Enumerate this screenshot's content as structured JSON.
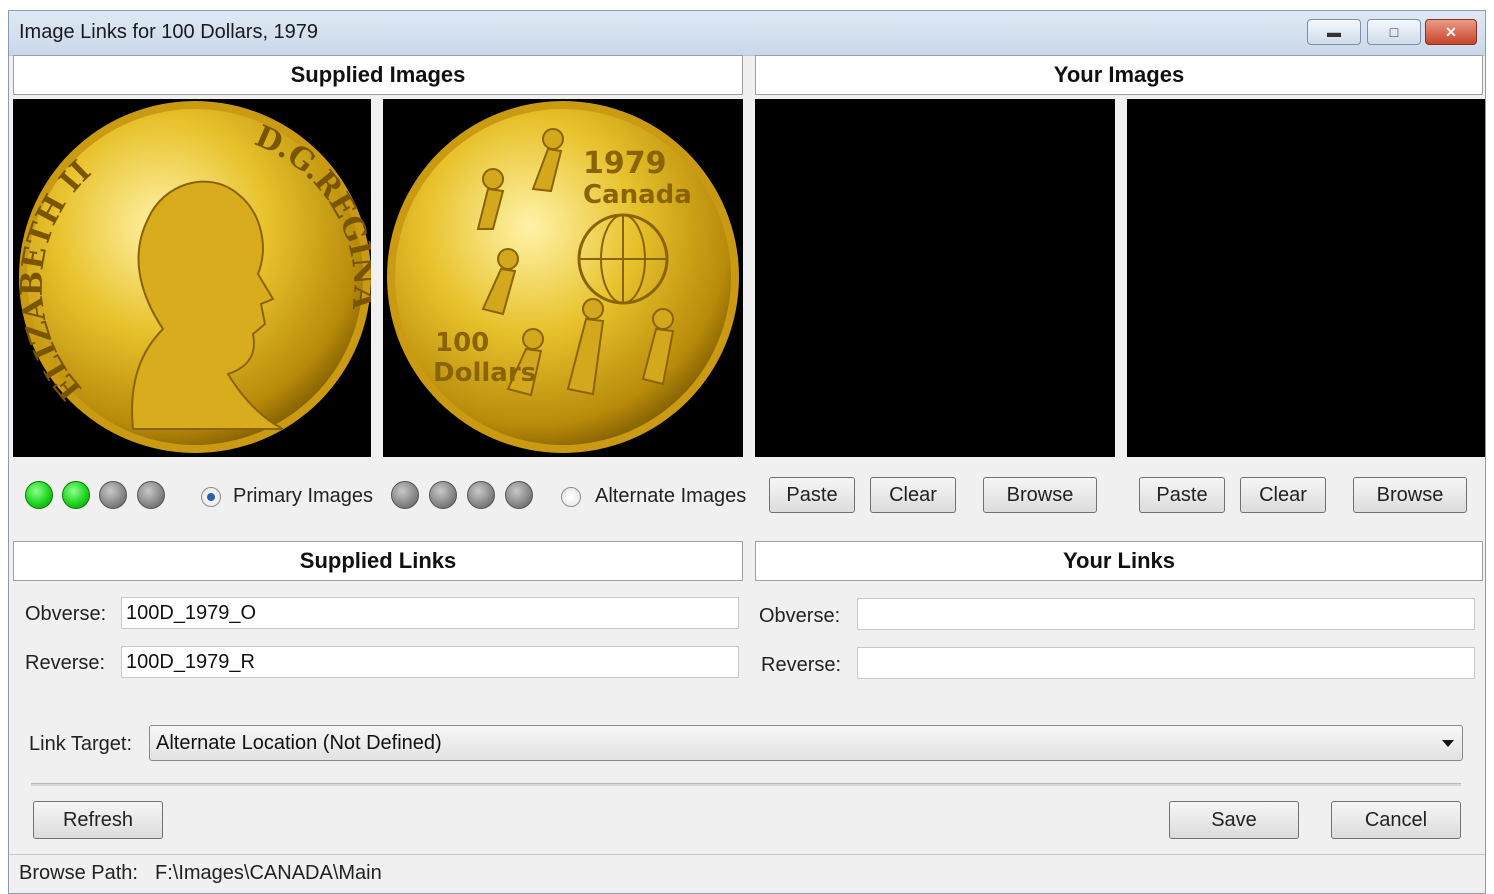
{
  "window": {
    "title": "Image Links for 100 Dollars, 1979",
    "min_icon": "minimize-icon",
    "max_icon": "maximize-icon",
    "close_icon": "close-icon"
  },
  "supplied_images": {
    "header": "Supplied Images",
    "obverse_legend_left": "ELIZABETH II",
    "obverse_legend_right": "D.G.REGINA",
    "reverse_year": "1979",
    "reverse_country": "Canada",
    "reverse_value_top": "100",
    "reverse_value_bottom": "Dollars",
    "primary_label": "Primary Images",
    "alternate_label": "Alternate Images",
    "primary_selected": true
  },
  "your_images": {
    "header": "Your Images",
    "paste_label": "Paste",
    "clear_label": "Clear",
    "browse_label": "Browse"
  },
  "supplied_links": {
    "header": "Supplied Links",
    "obverse_label": "Obverse:",
    "obverse_value": "100D_1979_O",
    "reverse_label": "Reverse:",
    "reverse_value": "100D_1979_R"
  },
  "your_links": {
    "header": "Your Links",
    "obverse_label": "Obverse:",
    "obverse_value": "",
    "reverse_label": "Reverse:",
    "reverse_value": ""
  },
  "link_target": {
    "label": "Link Target:",
    "value": "Alternate Location (Not Defined)"
  },
  "buttons": {
    "refresh": "Refresh",
    "save": "Save",
    "cancel": "Cancel"
  },
  "status": {
    "label": "Browse Path:",
    "path": "F:\\Images\\CANADA\\Main"
  },
  "colors": {
    "gold_light": "#f7e27a",
    "gold_dark": "#a97a06",
    "indicator_green": "#1fd41f",
    "indicator_gray": "#8a8a8a"
  }
}
